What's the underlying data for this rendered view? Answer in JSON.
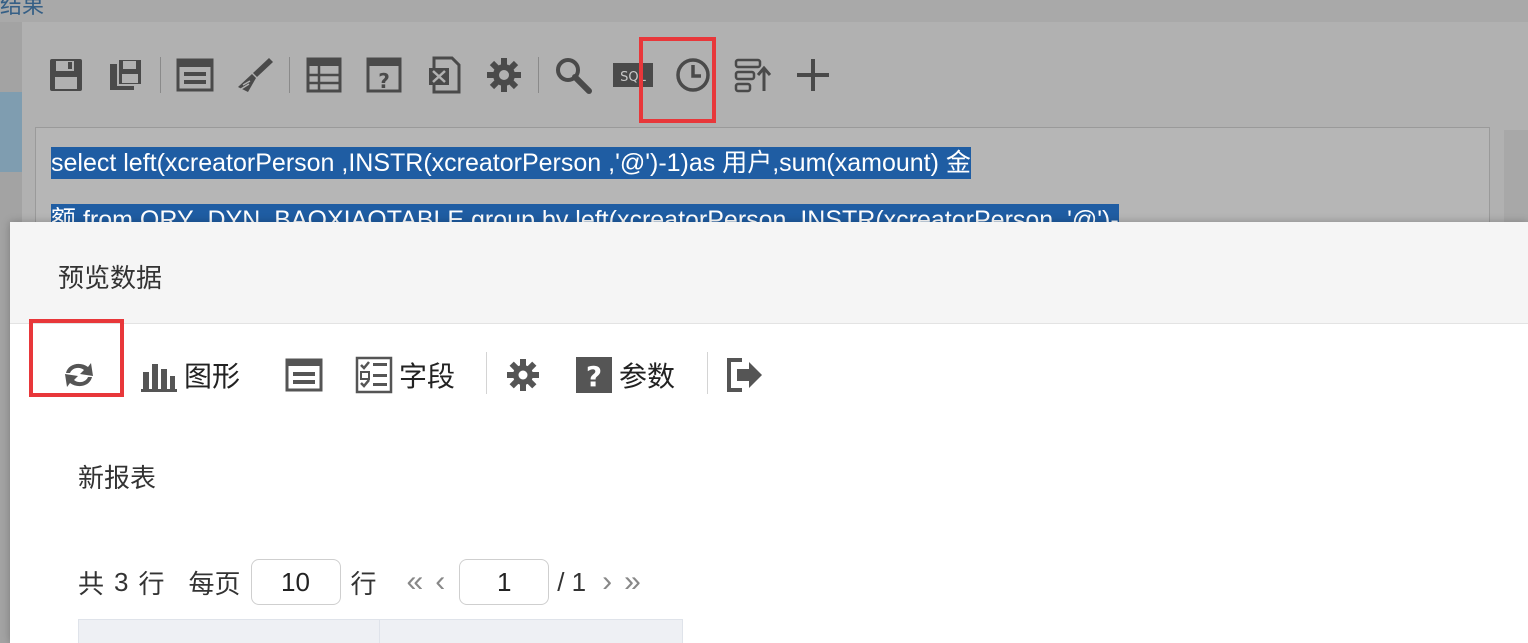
{
  "background": {
    "top_text": "结果",
    "sql_lines": [
      "select   left(xcreatorPerson  ,INSTR(xcreatorPerson  ,'@')-1)as 用户,sum(xamount) 金",
      "额 from  QRY_DYN_BAOXIAOTABLE group by   left(xcreatorPerson  ,INSTR(xcreatorPerson  ,'@')-"
    ],
    "toolbar_icons": [
      "save-icon",
      "save-as-icon",
      "layout-icon",
      "brush-icon",
      "table-icon",
      "help-table-icon",
      "excel-icon",
      "gear-icon",
      "search-icon",
      "sql-icon",
      "clock-icon",
      "sort-icon",
      "plus-icon"
    ],
    "sql_badge": "SQL"
  },
  "modal": {
    "title": "预览数据",
    "toolbar": {
      "chart_label": "图形",
      "fields_label": "字段",
      "params_label": "参数"
    },
    "report_title": "新报表",
    "pager": {
      "total_prefix": "共",
      "total_rows": "3",
      "total_suffix": "行",
      "per_page_label": "每页",
      "page_size": "10",
      "rows_label": "行",
      "first": "«",
      "prev": "‹",
      "current_page": "1",
      "of_pages": "/ 1",
      "next": "›",
      "last": "»"
    }
  },
  "colors": {
    "highlight": "#e8373a",
    "selection": "#1f5da3"
  }
}
